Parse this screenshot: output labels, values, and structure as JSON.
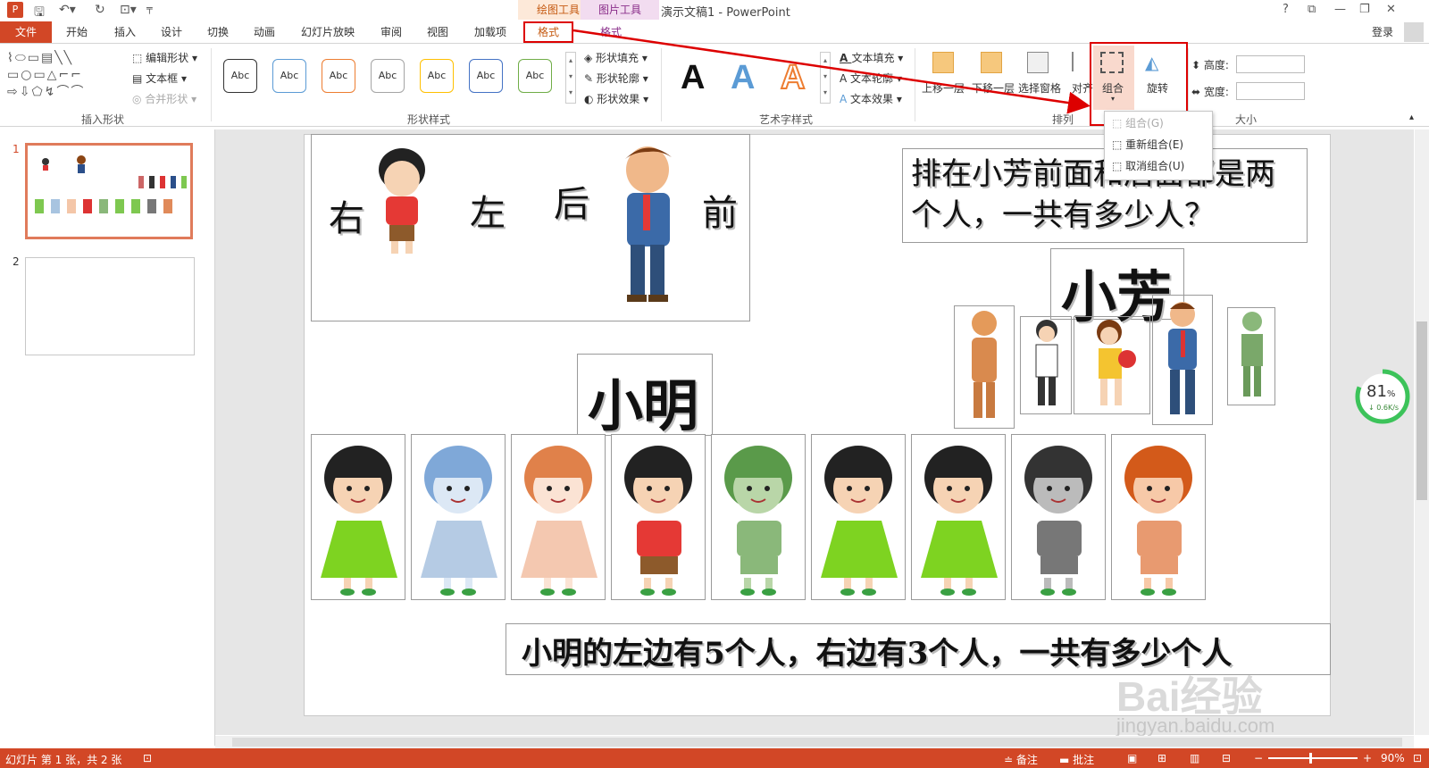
{
  "titlebar": {
    "context_draw": "绘图工具",
    "context_picture": "图片工具",
    "doc_title": "演示文稿1 - PowerPoint",
    "login": "登录"
  },
  "tabs": [
    "文件",
    "开始",
    "插入",
    "设计",
    "切换",
    "动画",
    "幻灯片放映",
    "审阅",
    "视图",
    "加载项",
    "格式",
    "格式"
  ],
  "ribbon": {
    "insert_shapes": {
      "edit_shape": "编辑形状",
      "textbox": "文本框",
      "merge_shape": "合并形状",
      "label": "插入形状"
    },
    "shape_styles": {
      "samples": [
        "Abc",
        "Abc",
        "Abc",
        "Abc",
        "Abc",
        "Abc",
        "Abc"
      ],
      "colors": [
        "#333333",
        "#5b9bd5",
        "#ed7d31",
        "#a5a5a5",
        "#ffc000",
        "#4472c4",
        "#70ad47"
      ],
      "fill": "形状填充",
      "outline": "形状轮廓",
      "effect": "形状效果",
      "label": "形状样式"
    },
    "wordart": {
      "letters": [
        "A",
        "A",
        "A"
      ],
      "text_fill": "文本填充",
      "text_outline": "文本轮廓",
      "text_effect": "文本效果",
      "label": "艺术字样式"
    },
    "arrange": {
      "bring_forward": "上移一层",
      "send_backward": "下移一层",
      "selection_pane": "选择窗格",
      "align": "对齐",
      "group": "组合",
      "rotate": "旋转",
      "label": "排列"
    },
    "size": {
      "height": "高度:",
      "width": "宽度:",
      "label": "大小"
    }
  },
  "group_menu": {
    "items": [
      "组合(G)",
      "重新组合(E)",
      "取消组合(U)"
    ]
  },
  "thumbs": {
    "n1": "1",
    "n2": "2"
  },
  "slide": {
    "dir_right": "右",
    "dir_left": "左",
    "dir_back": "后",
    "dir_front": "前",
    "question1": "排在小芳前面和后面都是两个人，一共有多少人？",
    "xiaofang": "小芳",
    "xiaoming": "小明",
    "question2": "小明的左边有5个人，右边有3个人，一共有多少个人"
  },
  "gauge": {
    "percent": "81",
    "unit": "%",
    "speed": "↓ 0.6K/s",
    "level": 0.81
  },
  "status": {
    "slide_info": "幻灯片 第 1 张，共 2 张",
    "notes": "备注",
    "comments": "批注",
    "zoom": "90%"
  },
  "watermark": {
    "brand": "Bai经验",
    "url": "jingyan.baidu.com"
  }
}
